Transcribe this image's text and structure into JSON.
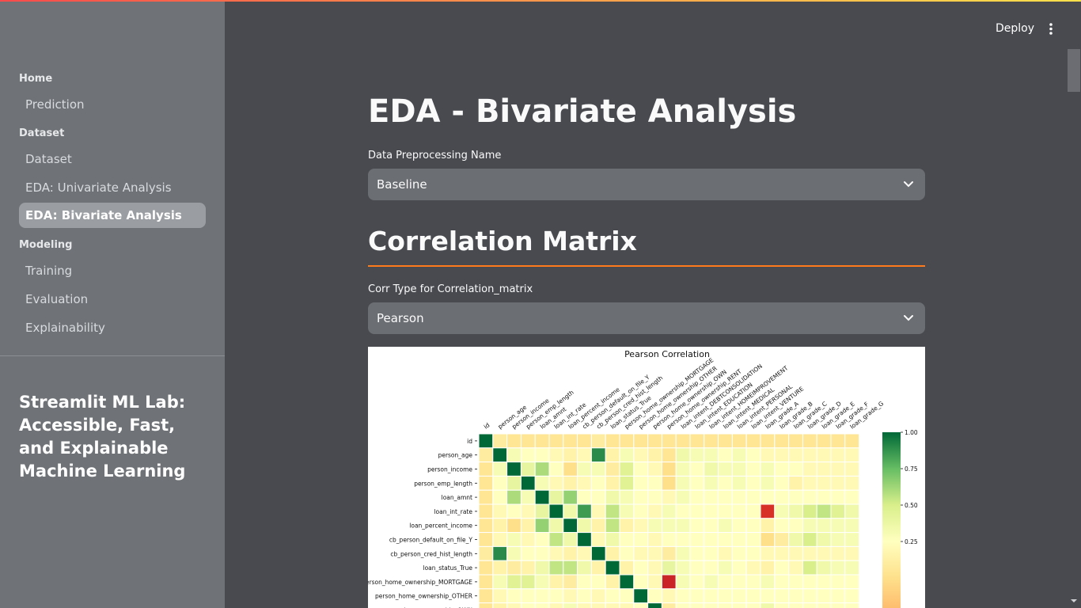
{
  "sidebar": {
    "sections": [
      {
        "title": "Home",
        "items": [
          {
            "label": "Prediction",
            "active": false
          }
        ]
      },
      {
        "title": "Dataset",
        "items": [
          {
            "label": "Dataset",
            "active": false
          },
          {
            "label": "EDA: Univariate Analysis",
            "active": false
          },
          {
            "label": "EDA: Bivariate Analysis",
            "active": true
          }
        ]
      },
      {
        "title": "Modeling",
        "items": [
          {
            "label": "Training",
            "active": false
          },
          {
            "label": "Evaluation",
            "active": false
          },
          {
            "label": "Explainability",
            "active": false
          }
        ]
      }
    ],
    "app_title": "Streamlit ML Lab: Accessible, Fast, and Explainable Machine Learning"
  },
  "header": {
    "deploy_label": "Deploy",
    "menu_icon": "vertical-dots-icon"
  },
  "main": {
    "page_title": "EDA - Bivariate Analysis",
    "preprocessing_label": "Data Preprocessing Name",
    "preprocessing_value": "Baseline",
    "section_heading": "Correlation Matrix",
    "corr_type_label": "Corr Type for Correlation_matrix",
    "corr_type_value": "Pearson"
  },
  "colors": {
    "accent_rule": "#ff7a1a",
    "active_nav_bg": "#9a9da1",
    "sidebar_bg": "#6f7276",
    "main_bg": "#484a4f"
  },
  "chart_data": {
    "type": "heatmap",
    "title": "Pearson Correlation",
    "columns": [
      "id",
      "person_age",
      "person_income",
      "person_emp_length",
      "loan_amnt",
      "loan_int_rate",
      "loan_percent_income",
      "cb_person_default_on_file_Y",
      "cb_person_cred_hist_length",
      "loan_status_True",
      "person_home_ownership_MORTGAGE",
      "person_home_ownership_OTHER",
      "person_home_ownership_OWN",
      "person_home_ownership_RENT",
      "loan_intent_DEBTCONSOLIDATION",
      "loan_intent_EDUCATION",
      "loan_intent_HOMEIMPROVEMENT",
      "loan_intent_MEDICAL",
      "loan_intent_PERSONAL",
      "loan_intent_VENTURE",
      "loan_grade_A",
      "loan_grade_B",
      "loan_grade_C",
      "loan_grade_D",
      "loan_grade_E",
      "loan_grade_F",
      "loan_grade_G"
    ],
    "visible_rows": [
      "id",
      "person_age",
      "person_income",
      "person_emp_length",
      "loan_amnt",
      "loan_int_rate",
      "loan_percent_income",
      "cb_person_default_on_file_Y",
      "cb_person_cred_hist_length",
      "loan_status_True",
      "person_home_ownership_MORTGAGE",
      "person_home_ownership_OTHER",
      "person_home_ownership_OWN"
    ],
    "colorbar": {
      "ticks": [
        1.0,
        0.75,
        0.5,
        0.25
      ],
      "tick_labels": [
        "1.00",
        "0.75",
        "0.50",
        "0.25"
      ],
      "colormap": "RdYlGn"
    },
    "values": [
      [
        1,
        0.1,
        0.05,
        0.05,
        0.05,
        0.05,
        0.05,
        0.05,
        0.1,
        0.05,
        0.05,
        0.05,
        0.05,
        0.05,
        0.05,
        0.05,
        0.05,
        0.05,
        0.05,
        0.05,
        0.05,
        0.05,
        0.05,
        0.05,
        0.05,
        0.05,
        0.05
      ],
      [
        0.1,
        1,
        0.3,
        0.25,
        0.25,
        0.2,
        0.15,
        0.2,
        0.9,
        0.15,
        0.3,
        0.2,
        0.15,
        0.05,
        0.35,
        0.3,
        0.3,
        0.25,
        0.3,
        0.25,
        0.2,
        0.2,
        0.2,
        0.2,
        0.2,
        0.2,
        0.2
      ],
      [
        0.05,
        0.3,
        1,
        0.4,
        0.6,
        0.25,
        0.0,
        0.3,
        0.3,
        0.1,
        0.45,
        0.25,
        0.2,
        0.0,
        0.3,
        0.25,
        0.35,
        0.3,
        0.3,
        0.25,
        0.3,
        0.25,
        0.25,
        0.2,
        0.2,
        0.2,
        0.2
      ],
      [
        0.05,
        0.25,
        0.4,
        1,
        0.3,
        0.2,
        0.15,
        0.2,
        0.25,
        0.15,
        0.45,
        0.25,
        0.25,
        0.0,
        0.3,
        0.25,
        0.3,
        0.25,
        0.3,
        0.25,
        0.3,
        0.25,
        0.15,
        0.2,
        0.2,
        0.2,
        0.2
      ],
      [
        0.05,
        0.25,
        0.6,
        0.3,
        1,
        0.4,
        0.65,
        0.25,
        0.25,
        0.35,
        0.3,
        0.25,
        0.25,
        0.2,
        0.3,
        0.25,
        0.25,
        0.25,
        0.25,
        0.25,
        0.25,
        0.25,
        0.25,
        0.25,
        0.25,
        0.25,
        0.25
      ],
      [
        0.05,
        0.2,
        0.25,
        0.2,
        0.4,
        1,
        0.35,
        0.85,
        0.2,
        0.55,
        0.3,
        0.25,
        0.2,
        0.3,
        0.25,
        0.25,
        0.25,
        0.25,
        0.25,
        0.25,
        -0.6,
        0.3,
        0.35,
        0.5,
        0.55,
        0.45,
        0.35
      ],
      [
        0.05,
        0.15,
        0.0,
        0.15,
        0.65,
        0.35,
        1,
        0.35,
        0.15,
        0.55,
        0.15,
        0.2,
        0.3,
        0.3,
        0.3,
        0.25,
        0.25,
        0.3,
        0.25,
        0.25,
        0.15,
        0.25,
        0.25,
        0.3,
        0.3,
        0.3,
        0.3
      ],
      [
        0.05,
        0.2,
        0.3,
        0.2,
        0.25,
        0.55,
        0.35,
        1,
        0.2,
        0.35,
        0.25,
        0.25,
        0.2,
        0.25,
        0.25,
        0.25,
        0.25,
        0.25,
        0.25,
        0.25,
        0.0,
        0.1,
        0.35,
        0.5,
        0.35,
        0.3,
        0.3
      ],
      [
        0.1,
        0.9,
        0.3,
        0.25,
        0.25,
        0.2,
        0.15,
        0.2,
        1,
        0.15,
        0.25,
        0.2,
        0.2,
        0.1,
        0.3,
        0.25,
        0.25,
        0.2,
        0.25,
        0.25,
        0.2,
        0.2,
        0.2,
        0.2,
        0.2,
        0.2,
        0.2
      ],
      [
        0.05,
        0.15,
        0.1,
        0.15,
        0.35,
        0.55,
        0.55,
        0.35,
        0.15,
        1,
        0.15,
        0.25,
        0.2,
        0.4,
        0.3,
        0.25,
        0.25,
        0.3,
        0.25,
        0.2,
        0.15,
        0.25,
        0.2,
        0.5,
        0.35,
        0.3,
        0.3
      ],
      [
        0.05,
        0.3,
        0.45,
        0.45,
        0.3,
        0.15,
        0.1,
        0.25,
        0.25,
        0.15,
        1,
        0.25,
        0.2,
        -0.7,
        0.3,
        0.25,
        0.3,
        0.25,
        0.25,
        0.25,
        0.3,
        0.25,
        0.25,
        0.25,
        0.25,
        0.25,
        0.25
      ],
      [
        0.05,
        0.2,
        0.25,
        0.25,
        0.25,
        0.25,
        0.2,
        0.25,
        0.2,
        0.25,
        0.25,
        1,
        0.25,
        0.2,
        0.25,
        0.25,
        0.25,
        0.25,
        0.25,
        0.25,
        0.25,
        0.25,
        0.25,
        0.25,
        0.25,
        0.25,
        0.25
      ],
      [
        0.05,
        0.15,
        0.2,
        0.25,
        0.25,
        0.2,
        0.3,
        0.2,
        0.2,
        0.2,
        0.2,
        0.25,
        1,
        0.1,
        0.25,
        0.25,
        0.25,
        0.25,
        0.25,
        0.25,
        0.35,
        0.25,
        0.25,
        0.25,
        0.25,
        0.25,
        0.25
      ]
    ]
  }
}
